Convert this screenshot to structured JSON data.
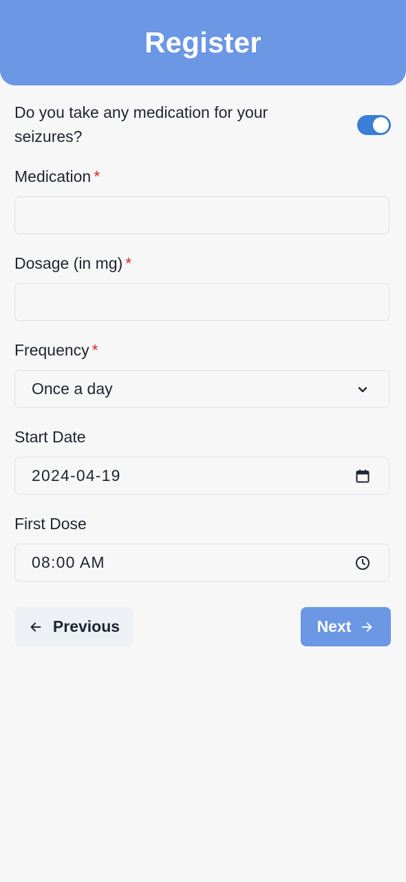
{
  "header": {
    "title": "Register"
  },
  "medication_question": {
    "text": "Do you take any medication for your seizures?",
    "toggle_on": true
  },
  "fields": {
    "medication": {
      "label": "Medication",
      "required_mark": "*",
      "value": ""
    },
    "dosage": {
      "label": "Dosage (in mg)",
      "required_mark": "*",
      "value": ""
    },
    "frequency": {
      "label": "Frequency",
      "required_mark": "*",
      "selected": "Once a day"
    },
    "start_date": {
      "label": "Start Date",
      "value": "2024-04-19"
    },
    "first_dose": {
      "label": "First Dose",
      "value": "08:00 AM"
    }
  },
  "buttons": {
    "previous_label": "Previous",
    "next_label": "Next"
  },
  "icons": {
    "frequency_dropdown": "chevron-down-icon",
    "start_date": "calendar-icon",
    "first_dose": "clock-icon",
    "previous": "arrow-left-icon",
    "next": "arrow-right-icon"
  },
  "colors": {
    "header_background": "#6b97e4",
    "toggle_on": "#3a7fd5",
    "required_mark": "#e02424",
    "next_button": "#6b97e4",
    "previous_button": "#edf1f6",
    "page_background": "#f7f7f7"
  }
}
